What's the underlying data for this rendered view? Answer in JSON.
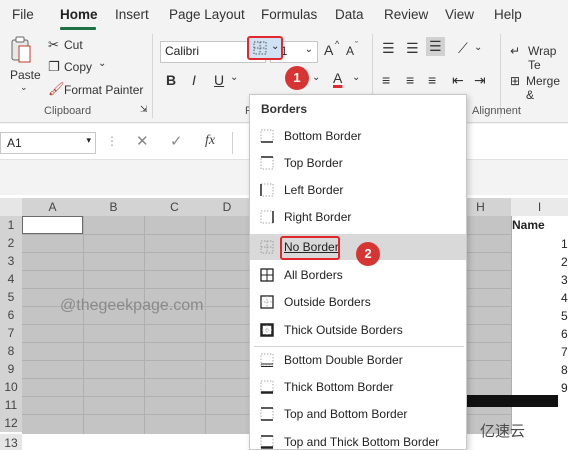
{
  "menu": {
    "tabs": [
      "File",
      "Home",
      "Insert",
      "Page Layout",
      "Formulas",
      "Data",
      "Review",
      "View",
      "Help"
    ],
    "active": "Home"
  },
  "ribbon": {
    "paste": "Paste",
    "cut": "Cut",
    "copy": "Copy",
    "format_painter": "Format Painter",
    "clipboard": "Clipboard",
    "font_name": "Calibri",
    "font_size": "11",
    "bold": "B",
    "italic": "I",
    "underline": "U",
    "font_group": "F",
    "wrap_text": "Wrap Te",
    "merge": "Merge &",
    "alignment": "Alignment",
    "grow_font": "A",
    "shrink_font": "A",
    "font_color": "A"
  },
  "formula_bar": {
    "name_box": "A1",
    "fx": "fx"
  },
  "grid": {
    "columns": [
      "A",
      "B",
      "C",
      "D",
      "H",
      "I"
    ],
    "rows": [
      "1",
      "2",
      "3",
      "4",
      "5",
      "6",
      "7",
      "8",
      "9",
      "10",
      "11",
      "12",
      "13"
    ],
    "header_name": "Name",
    "values": [
      "1",
      "2",
      "3",
      "4",
      "5",
      "6",
      "7",
      "8",
      "9"
    ],
    "watermark": "@thegeekpage.com",
    "watermark2": "亿速云"
  },
  "borders_menu": {
    "title": "Borders",
    "items": [
      "Bottom Border",
      "Top Border",
      "Left Border",
      "Right Border",
      "No Border",
      "All Borders",
      "Outside Borders",
      "Thick Outside Borders",
      "Bottom Double Border",
      "Thick Bottom Border",
      "Top and Bottom Border",
      "Top and Thick Bottom Border"
    ],
    "highlighted": "No Border"
  },
  "badges": [
    "1",
    "2"
  ],
  "colors": {
    "accent": "#1e7145",
    "highlight": "#e1282c",
    "badge": "#d73533",
    "selection": "#c4c4c4"
  }
}
